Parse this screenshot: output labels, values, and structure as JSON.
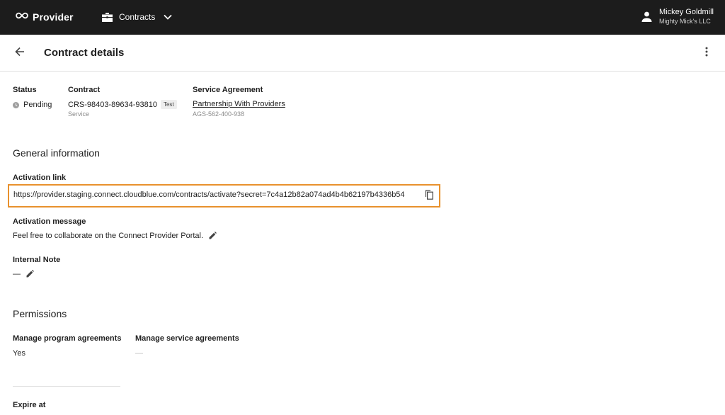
{
  "topbar": {
    "brand": "Provider",
    "nav_label": "Contracts",
    "user_name": "Mickey Goldmill",
    "user_org": "Mighty Mick's LLC"
  },
  "header": {
    "title": "Contract details"
  },
  "summary": {
    "status_label": "Status",
    "status_value": "Pending",
    "contract_label": "Contract",
    "contract_id": "CRS-98403-89634-93810",
    "contract_badge": "Test",
    "contract_type": "Service",
    "agreement_label": "Service Agreement",
    "agreement_name": "Partnership With Providers",
    "agreement_id": "AGS-562-400-938"
  },
  "general": {
    "title": "General information",
    "activation_link_label": "Activation link",
    "activation_link": "https://provider.staging.connect.cloudblue.com/contracts/activate?secret=7c4a12b82a074ad4b4b62197b4336b54",
    "activation_message_label": "Activation message",
    "activation_message": "Feel free to collaborate on the Connect Provider Portal.",
    "internal_note_label": "Internal Note",
    "internal_note": "—"
  },
  "permissions": {
    "title": "Permissions",
    "program_label": "Manage program agreements",
    "program_value": "Yes",
    "service_label": "Manage service agreements",
    "service_value": "—"
  },
  "expire": {
    "label": "Expire at"
  },
  "colors": {
    "topbar_bg": "#1c1c1c",
    "highlight": "#e8912d",
    "status_pending": "#9e9e9e"
  },
  "icons": [
    "infinity-icon",
    "briefcase-icon",
    "chevron-down-icon",
    "person-icon",
    "arrow-back-icon",
    "more-vert-icon",
    "copy-icon",
    "pencil-icon",
    "clock-icon"
  ]
}
